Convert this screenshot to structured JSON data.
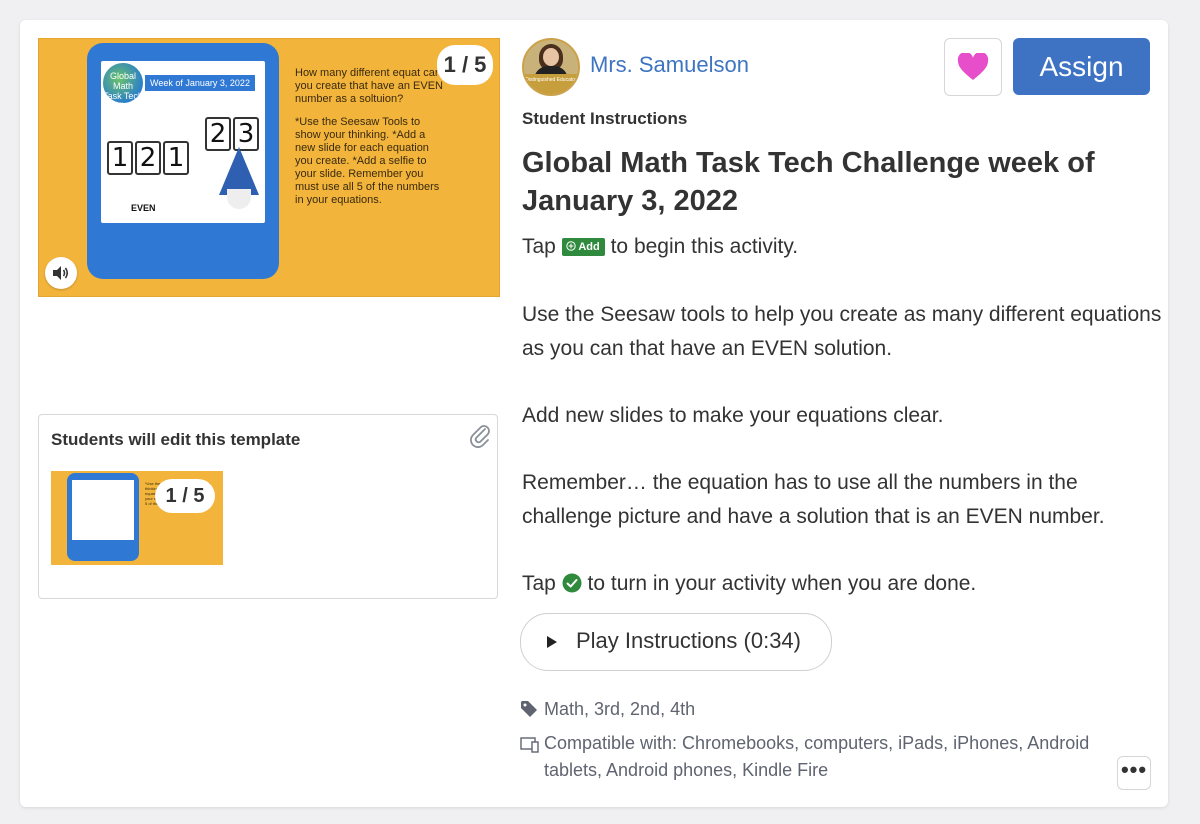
{
  "preview": {
    "counter": "1 / 5",
    "globe_text": "Global Math Task Tech Challenge",
    "week_banner": "Week of January 3, 2022",
    "digits": [
      "1",
      "2",
      "1",
      "2",
      "3"
    ],
    "even_label": "EVEN",
    "slide_lines": [
      "How many different equat can you create that have an EVEN number as a soltuion?",
      "*Use the Seesaw Tools to show your thinking. *Add a new slide for each equation you create. *Add a selfie to your slide. Remember you must use all 5 of the numbers in your equations."
    ]
  },
  "template": {
    "title": "Students will edit this template",
    "counter": "1 / 5"
  },
  "teacher": {
    "name": "Mrs. Samuelson",
    "badge": "Distinguished Educator"
  },
  "actions": {
    "assign": "Assign"
  },
  "colors": {
    "accent": "#3e73c4",
    "heart": "#e64fc9",
    "slide_bg": "#f2b43a",
    "add_green": "#2f8a3d"
  },
  "instructions": {
    "section_label": "Student Instructions",
    "title": "Global Math Task Tech Challenge week of January 3, 2022",
    "tap": "Tap",
    "add_badge": "Add",
    "begin": "to begin this activity.",
    "para1": "Use the Seesaw tools to help you create as many different equations as you can that have an EVEN solution.",
    "para2": "Add new slides to make your equations clear.",
    "para3": "Remember… the equation has to use all the numbers in the challenge picture and have a solution that is an EVEN number.",
    "turn_in": "to turn in your activity when you are done.",
    "play": "Play Instructions (0:34)"
  },
  "meta": {
    "tags": "Math, 3rd, 2nd, 4th",
    "compatible": "Compatible with: Chromebooks, computers, iPads, iPhones, Android tablets, Android phones, Kindle Fire"
  },
  "icons": [
    "speaker-icon",
    "paperclip-icon",
    "heart-icon",
    "add-icon",
    "check-circle-icon",
    "play-icon",
    "tag-icon",
    "devices-icon",
    "more-icon"
  ]
}
